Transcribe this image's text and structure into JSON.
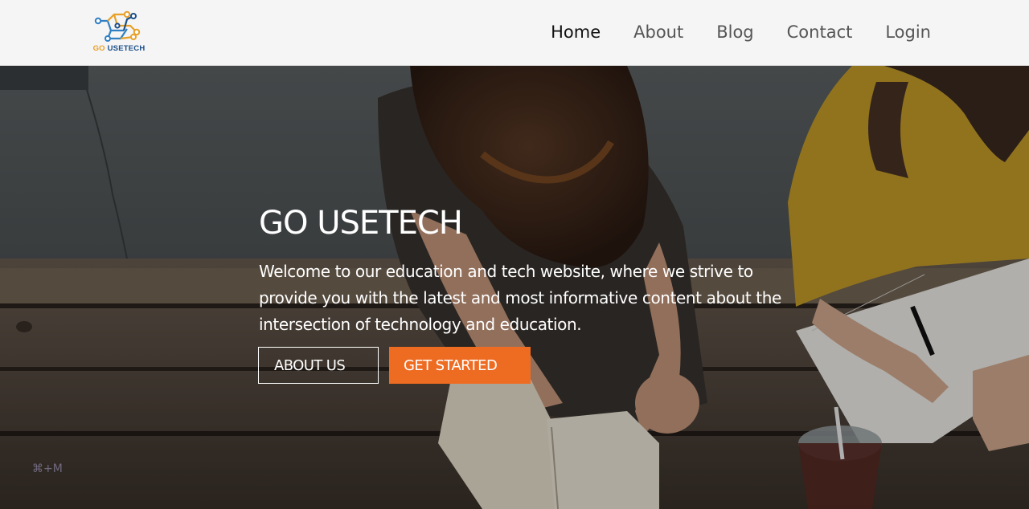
{
  "header": {
    "logo": {
      "text_go": "GO",
      "text_rest": "USETECH",
      "icon": "circuit-board-icon"
    },
    "nav": [
      {
        "label": "Home",
        "active": true
      },
      {
        "label": "About",
        "active": false
      },
      {
        "label": "Blog",
        "active": false
      },
      {
        "label": "Contact",
        "active": false
      },
      {
        "label": "Login",
        "active": false
      }
    ]
  },
  "hero": {
    "title": "GO USETECH",
    "text": "Welcome to our education and tech website, where we strive to provide you with the latest and most informative content about the intersection of technology and education.",
    "buttons": {
      "about_label": "ABOUT US",
      "start_label": "GET STARTED"
    },
    "background": "students-studying-photo",
    "watermark": "⌘+M"
  },
  "colors": {
    "accent": "#ee6b22",
    "header_bg": "#f5f5f5",
    "logo_blue": "#1a4f8a",
    "logo_orange": "#e8a028"
  }
}
